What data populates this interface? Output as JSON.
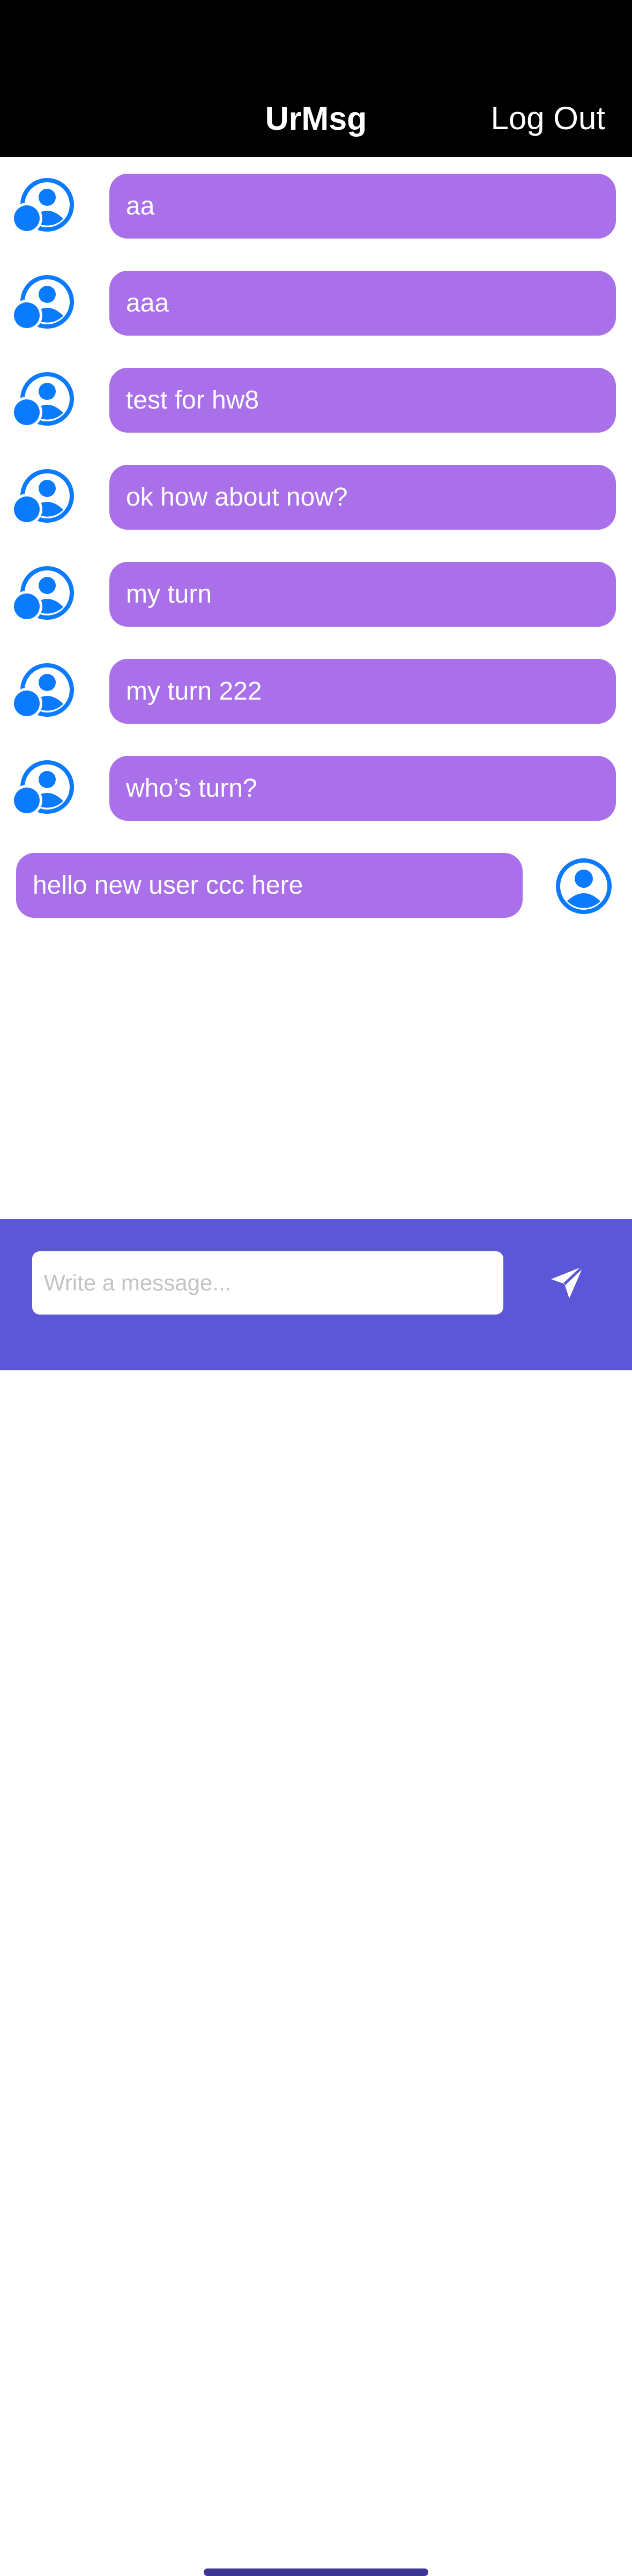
{
  "header": {
    "title": "UrMsg",
    "logout_label": "Log Out"
  },
  "messages": [
    {
      "text": "aa",
      "sender": "other"
    },
    {
      "text": "aaa",
      "sender": "other"
    },
    {
      "text": "test for hw8",
      "sender": "other"
    },
    {
      "text": "ok how about now?",
      "sender": "other"
    },
    {
      "text": "my turn",
      "sender": "other"
    },
    {
      "text": "my turn 222",
      "sender": "other"
    },
    {
      "text": "who’s turn?",
      "sender": "other"
    },
    {
      "text": "hello new user ccc here",
      "sender": "self"
    }
  ],
  "composer": {
    "placeholder": "Write a message...",
    "value": "",
    "send_icon": "paper-plane-icon"
  },
  "icons": {
    "other_avatar": "group-user-icon",
    "self_avatar": "user-circle-icon"
  },
  "colors": {
    "header_bg": "#000000",
    "bubble": "#a970ea",
    "avatar": "#0a7aff",
    "composer_bg": "#5b57d7",
    "send_icon": "#ffffff"
  }
}
